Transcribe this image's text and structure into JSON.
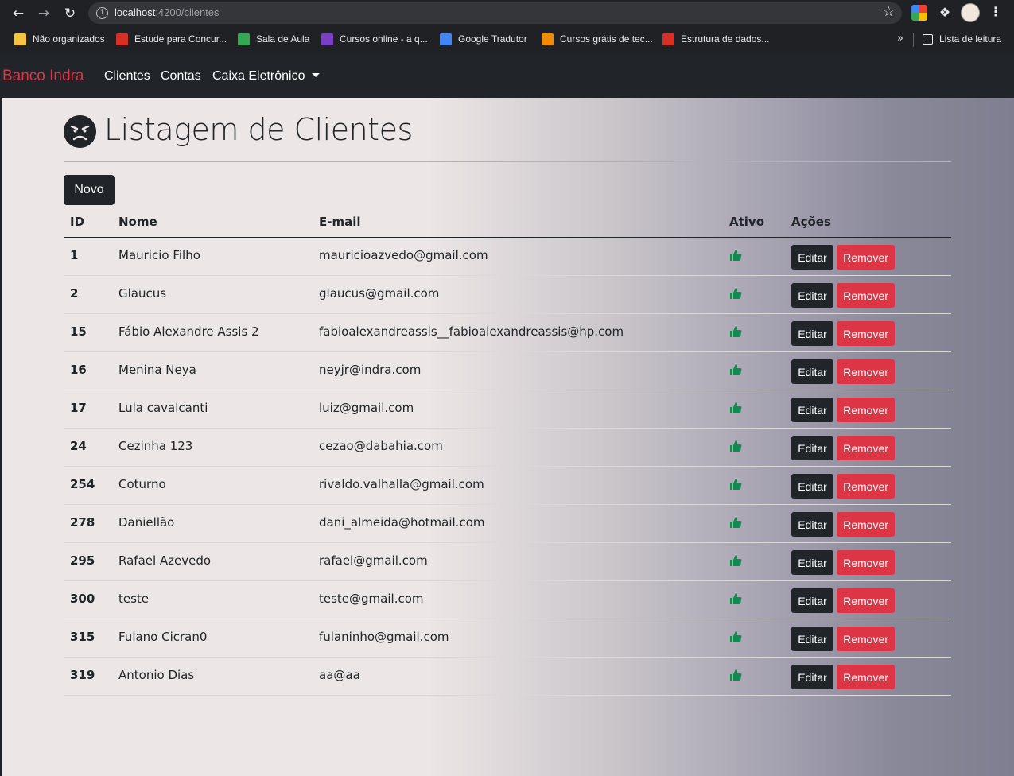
{
  "browser": {
    "url_host": "localhost",
    "url_path": ":4200/clientes",
    "bookmarks": [
      {
        "label": "Não organizados",
        "color": "#f4c542"
      },
      {
        "label": "Estude para Concur...",
        "color": "#d93025"
      },
      {
        "label": "Sala de Aula",
        "color": "#34a853"
      },
      {
        "label": "Cursos online - a q...",
        "color": "#7b3fc4"
      },
      {
        "label": "Google Tradutor",
        "color": "#4285f4"
      },
      {
        "label": "Cursos grátis de tec...",
        "color": "#f28b00"
      },
      {
        "label": "Estrutura de dados...",
        "color": "#d93025"
      }
    ],
    "reading_list": "Lista de leitura"
  },
  "navbar": {
    "brand": "Banco Indra",
    "links": [
      "Clientes",
      "Contas",
      "Caixa Eletrônico"
    ],
    "brand_color": "#dc3545"
  },
  "page": {
    "title": "Listagem de Clientes",
    "new_button": "Novo"
  },
  "table": {
    "headers": [
      "ID",
      "Nome",
      "E-mail",
      "Ativo",
      "Ações"
    ],
    "edit_label": "Editar",
    "remove_label": "Remover",
    "active_icon": "thumbs-up-icon",
    "active_color": "#198754",
    "rows": [
      {
        "id": "1",
        "nome": "Mauricio Filho",
        "email": "mauricioazvedo@gmail.com"
      },
      {
        "id": "2",
        "nome": "Glaucus",
        "email": "glaucus@gmail.com"
      },
      {
        "id": "15",
        "nome": "Fábio Alexandre Assis 2",
        "email": "fabioalexandreassis__fabioalexandreassis@hp.com"
      },
      {
        "id": "16",
        "nome": "Menina Neya",
        "email": "neyjr@indra.com"
      },
      {
        "id": "17",
        "nome": "Lula cavalcanti",
        "email": "luiz@gmail.com"
      },
      {
        "id": "24",
        "nome": "Cezinha 123",
        "email": "cezao@dabahia.com"
      },
      {
        "id": "254",
        "nome": "Coturno",
        "email": "rivaldo.valhalla@gmail.com"
      },
      {
        "id": "278",
        "nome": "Daniellão",
        "email": "dani_almeida@hotmail.com"
      },
      {
        "id": "295",
        "nome": "Rafael Azevedo",
        "email": "rafael@gmail.com"
      },
      {
        "id": "300",
        "nome": "teste",
        "email": "teste@gmail.com"
      },
      {
        "id": "315",
        "nome": "Fulano Cicran0",
        "email": "fulaninho@gmail.com"
      },
      {
        "id": "319",
        "nome": "Antonio Dias",
        "email": "aa@aa"
      }
    ]
  }
}
